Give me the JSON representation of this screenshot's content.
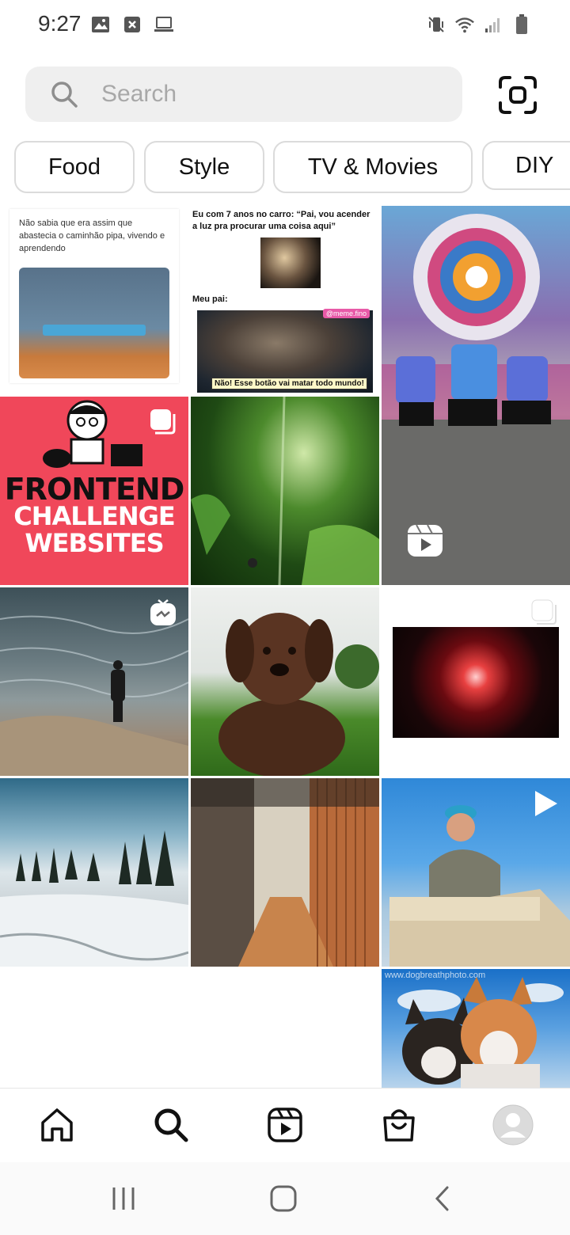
{
  "status_bar": {
    "time": "9:27",
    "left_icons": [
      "image-icon",
      "close-box-icon",
      "laptop-icon"
    ],
    "right_icons": [
      "vibrate-mute-icon",
      "wifi-icon",
      "signal-icon",
      "battery-icon"
    ]
  },
  "search": {
    "placeholder": "Search",
    "scan_icon": "scan-icon"
  },
  "chips": [
    "Food",
    "Style",
    "TV & Movies",
    "DIY"
  ],
  "grid": {
    "tiles": [
      {
        "id": "meme-truck",
        "text_lines": [
          "Não sabia que era assim que",
          "abastecia o caminhão pipa, vivendo e",
          "aprendendo"
        ]
      },
      {
        "id": "meme-raccoon",
        "text_lines": [
          "Eu com 7 anos no carro: “Pai, vou acender",
          "a luz pra procurar uma coisa aqui”",
          "Meu pai:",
          "@meme.fino",
          "Não! Esse botão vai matar todo mundo!"
        ]
      },
      {
        "id": "dancers",
        "badge": "reels-icon"
      },
      {
        "id": "frontend",
        "text_lines": [
          "FRONTEND",
          "CHALLENGE",
          "WEBSITES"
        ],
        "badge": "carousel-icon"
      },
      {
        "id": "jungle"
      },
      {
        "id": "sea-man",
        "badge": "igtv-icon"
      },
      {
        "id": "puppy"
      },
      {
        "id": "fire-night",
        "badge": "carousel-icon"
      },
      {
        "id": "snow-trees"
      },
      {
        "id": "wood-corridor"
      },
      {
        "id": "man-outdoor",
        "badge": "play-icon"
      },
      {
        "id": "corgis",
        "text_lines": [
          "www.dogbreathphoto.com"
        ]
      }
    ]
  },
  "bottom_nav": [
    "home-icon",
    "search-icon",
    "reels-icon",
    "shop-icon",
    "profile-avatar"
  ],
  "system_nav": [
    "recents-icon",
    "home-button-icon",
    "back-icon"
  ],
  "colors": {
    "frontend_bg": "#f0475a",
    "search_bg": "#efefef",
    "chip_border": "#dbdbdb"
  }
}
